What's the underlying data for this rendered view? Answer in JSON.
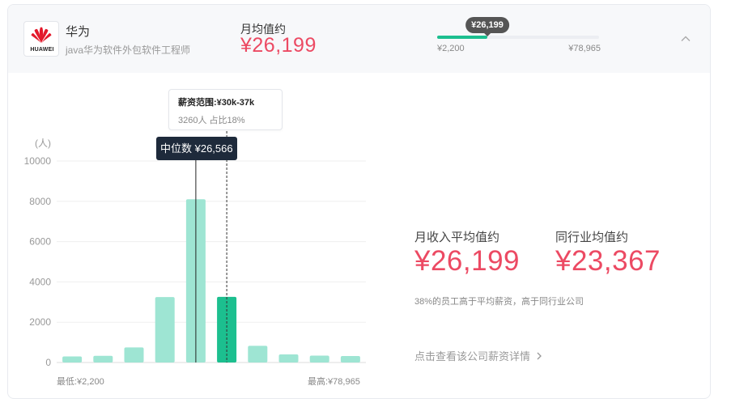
{
  "company": {
    "name": "华为",
    "subtitle": "java华为软件外包软件工程师",
    "logo_text": "HUAWEI"
  },
  "summary": {
    "avg_label": "月均值约",
    "avg_value": "¥26,199"
  },
  "range": {
    "tip": "¥26,199",
    "min_label": "¥2,200",
    "max_label": "¥78,965",
    "fraction": 0.31
  },
  "icons": {
    "collapse": "chevron-up-icon",
    "link_arrow": "chevron-right-icon"
  },
  "chart_data": {
    "type": "bar",
    "unit_label": "(人)",
    "ylim": [
      0,
      10000
    ],
    "y_ticks": [
      "0",
      "2000",
      "4000",
      "6000",
      "8000",
      "10000"
    ],
    "values": [
      300,
      330,
      750,
      3250,
      8100,
      3260,
      830,
      400,
      340,
      320
    ],
    "highlight_index": 5,
    "median_index": 4,
    "grid": true,
    "min_label": "最低:¥2,200",
    "max_label": "最高:¥78,965",
    "colors": {
      "bar": "#9ee5d3",
      "highlight": "#1cbf8f",
      "median_line": "#222222"
    },
    "tooltip": {
      "range": "薪资范围:¥30k-37k",
      "detail": "3260人  占比18%"
    },
    "median_tag": "中位数 ¥26,566"
  },
  "stats": {
    "monthly_label": "月收入平均值约",
    "monthly_value": "¥26,199",
    "industry_label": "同行业均值约",
    "industry_value": "¥23,367",
    "note": "38%的员工高于平均薪资，高于同行业公司",
    "link": "点击查看该公司薪资详情"
  },
  "colors": {
    "accent": "#1cbf8f",
    "price": "#ec4a63"
  }
}
